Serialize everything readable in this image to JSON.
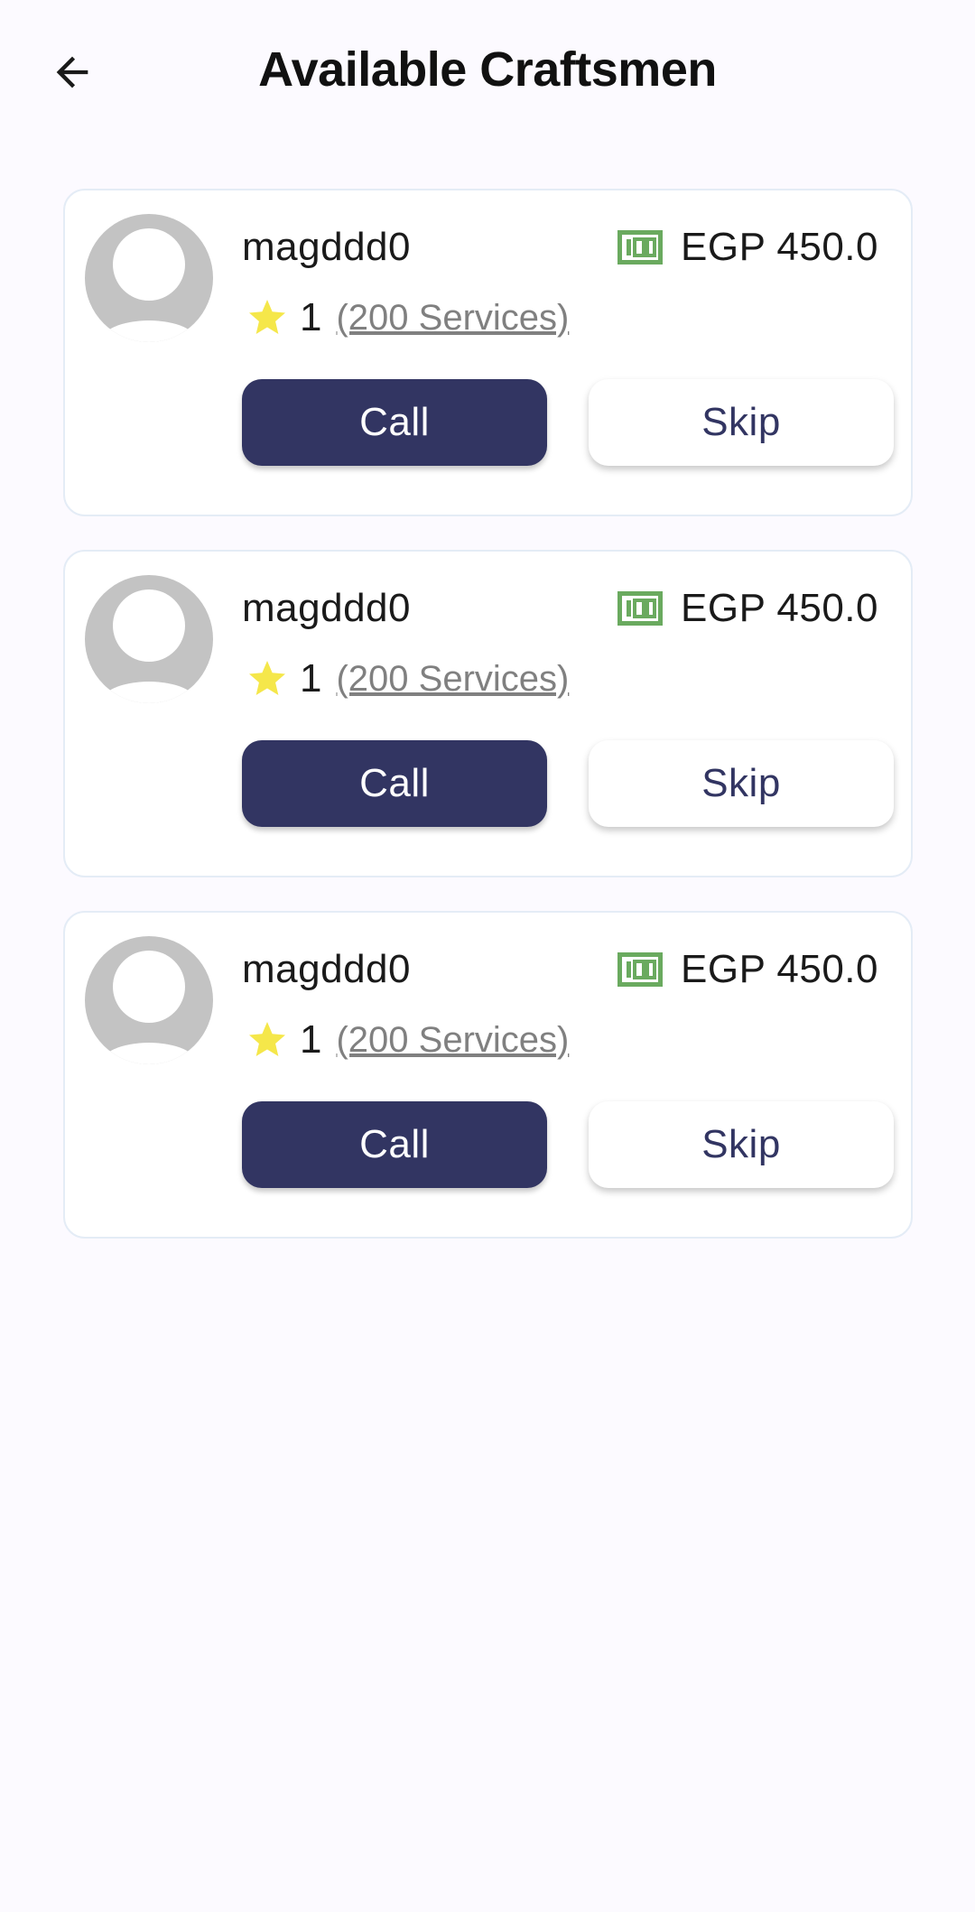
{
  "header": {
    "title": "Available Craftsmen",
    "back_icon": "arrow-left-icon"
  },
  "colors": {
    "background": "#fcfaff",
    "primary": "#323562",
    "money_green": "#6aaa5f",
    "star": "#f5e74a",
    "avatar_gray": "#c3c3c3",
    "services_gray": "#808080"
  },
  "craftsmen": [
    {
      "name": "magddd0",
      "price": "EGP 450.0",
      "rating": "1",
      "services": "(200 Services)",
      "call_label": "Call",
      "skip_label": "Skip"
    },
    {
      "name": "magddd0",
      "price": "EGP 450.0",
      "rating": "1",
      "services": "(200 Services)",
      "call_label": "Call",
      "skip_label": "Skip"
    },
    {
      "name": "magddd0",
      "price": "EGP 450.0",
      "rating": "1",
      "services": "(200 Services)",
      "call_label": "Call",
      "skip_label": "Skip"
    }
  ]
}
